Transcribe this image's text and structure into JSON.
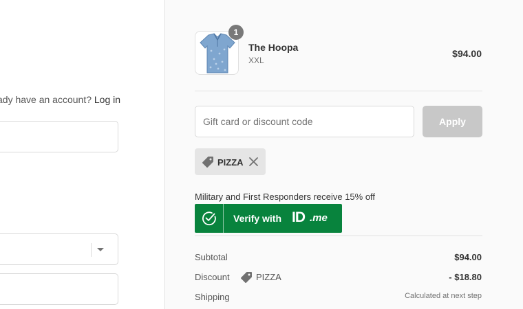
{
  "account": {
    "prompt": "ady have an account?",
    "login_link": "Log in"
  },
  "cart": {
    "item": {
      "name": "The Hoopa",
      "variant": "XXL",
      "price": "$94.00",
      "quantity": "1",
      "image_icon": "polo-shirt-thumbnail"
    }
  },
  "discount": {
    "placeholder": "Gift card or discount code",
    "apply_label": "Apply",
    "applied_code": "PIZZA"
  },
  "idme": {
    "promo_text": "Military and First Responders receive 15% off",
    "verify_label": "Verify with",
    "brand_id": "ID",
    "brand_me": ".me",
    "brand_color": "#08833d"
  },
  "summary": {
    "subtotal_label": "Subtotal",
    "subtotal_value": "$94.00",
    "discount_label": "Discount",
    "discount_code": "PIZZA",
    "discount_value": "- $18.80",
    "shipping_label": "Shipping",
    "shipping_value": "Calculated at next step"
  },
  "icons": [
    "tag-icon",
    "close-icon",
    "check-circle-icon",
    "chevron-down-icon"
  ]
}
